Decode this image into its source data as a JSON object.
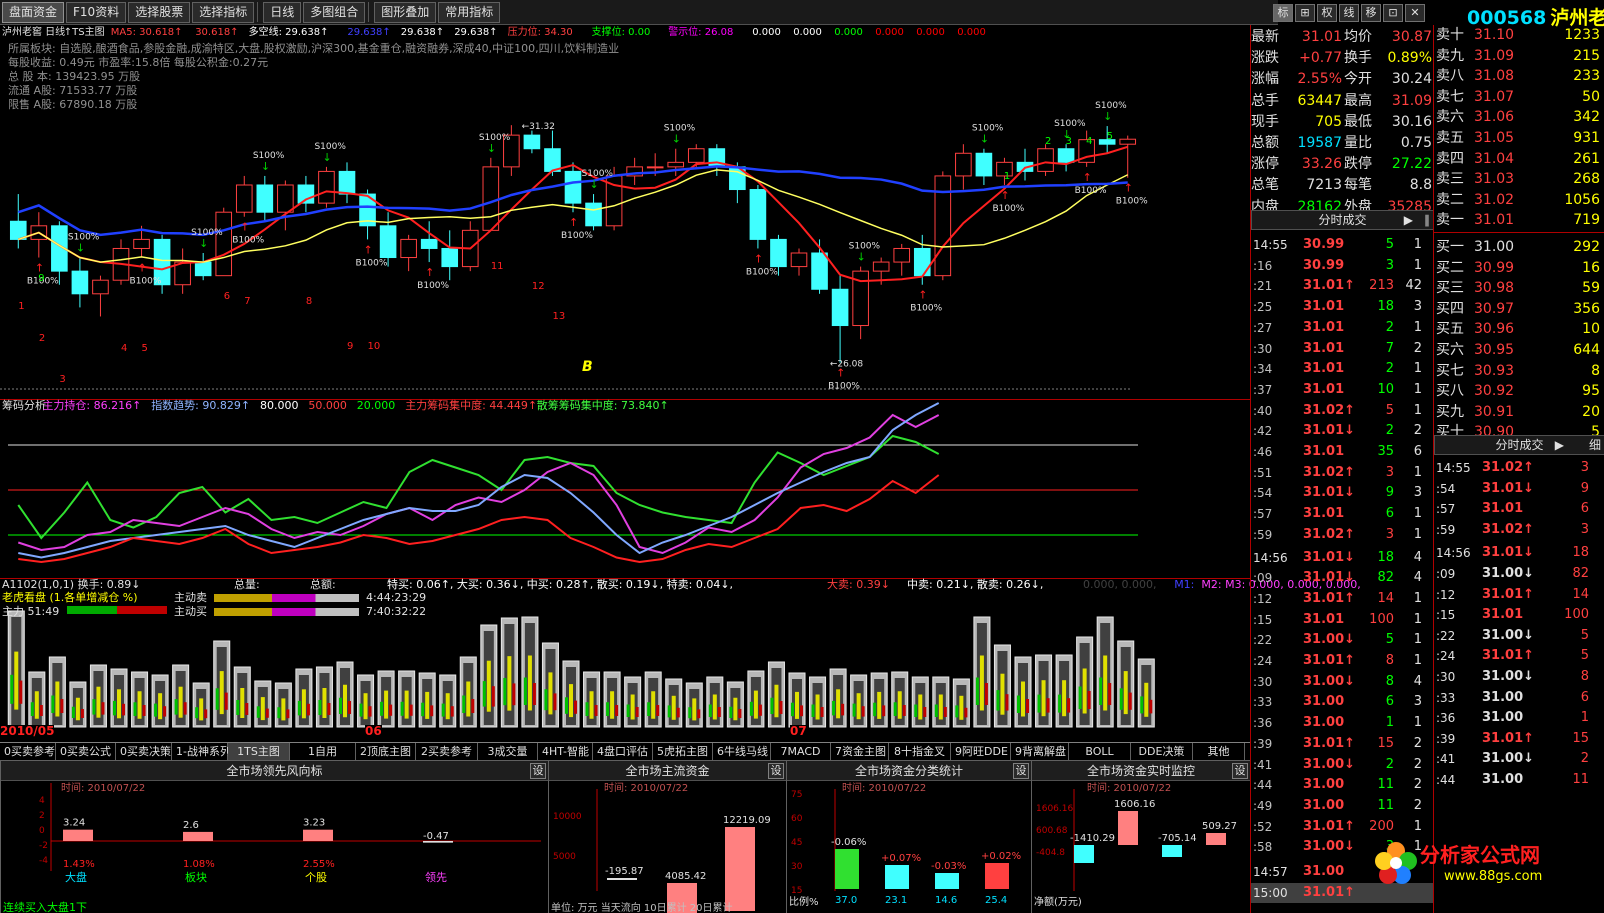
{
  "toolbar": {
    "items": [
      "盘面资金",
      "F10资料",
      "选择股票",
      "选择指标",
      "日线",
      "多图组合",
      "图形叠加",
      "常用指标"
    ],
    "right_tools": [
      "标",
      "⊞",
      "权",
      "线",
      "移",
      "⊡",
      "✕"
    ]
  },
  "stock": {
    "code": "000568",
    "name": "泸州老窖"
  },
  "chart": {
    "title_line": [
      {
        "t": "泸州老窖 日线",
        "c": "#e0e0e0"
      },
      {
        "t": "↑TS主图",
        "c": "#e0e0e0"
      },
      {
        "t": "MA5: 30.618↑",
        "c": "#ff4040"
      },
      {
        "t": "30.618↑",
        "c": "#ff4040"
      },
      {
        "t": "多空线: 29.638↑",
        "c": "#ffffff"
      },
      {
        "t": "29.638↑",
        "c": "#4040ff"
      },
      {
        "t": "29.638↑",
        "c": "#ffffff"
      },
      {
        "t": "29.638↑",
        "c": "#ffffff"
      },
      {
        "t": "压力位: 34.30",
        "c": "#ff4040"
      },
      {
        "t": "支撑位: 0.00",
        "c": "#00ff00"
      },
      {
        "t": "警示位: 26.08",
        "c": "#ff00ff"
      },
      {
        "t": "0.000",
        "c": "#ffffff"
      },
      {
        "t": "0.000",
        "c": "#ffffff"
      },
      {
        "t": "0.000",
        "c": "#00ff00"
      },
      {
        "t": "0.000",
        "c": "#ff0000"
      },
      {
        "t": "0.000",
        "c": "#ff0000"
      },
      {
        "t": "0.000",
        "c": "#ff0000"
      }
    ],
    "info_lines": [
      "所属板块: 自选股,酿酒食品,参股金融,成渝特区,大盘,股权激励,沪深300,基金重仓,融资融券,深成40,中证100,四川,饮料制造业",
      "每股收益: 0.49元   市盈率:15.8倍   每股公积金:0.27元",
      "总 股 本: 139423.95  万股",
      "流通 A股: 71533.77  万股",
      "限售 A股: 67890.18  万股"
    ],
    "annotations": {
      "high": "31.32",
      "low": "26.08",
      "buy": "B100%",
      "sell": "S100%",
      "b_mark": "B"
    },
    "num_labels": [
      "1",
      "2",
      "3",
      "4",
      "5",
      "6",
      "7",
      "8",
      "9",
      "10",
      "11",
      "12",
      "13",
      "1",
      "2",
      "3",
      "4",
      "5",
      "9"
    ],
    "ind_title": [
      {
        "t": "筹码分析",
        "c": "#e0e0e0"
      },
      {
        "t": "主力持仓: 86.216↑",
        "c": "#ff40ff"
      },
      {
        "t": "指数趋势: 90.829↑",
        "c": "#8fb4ff"
      },
      {
        "t": "80.000",
        "c": "#ffffff"
      },
      {
        "t": "50.000",
        "c": "#ff4040"
      },
      {
        "t": "20.000",
        "c": "#00ff00"
      },
      {
        "t": "主力筹码集中度: 44.449↑",
        "c": "#ff4040"
      },
      {
        "t": "散筹筹码集中度: 73.840↑",
        "c": "#40ff40"
      }
    ],
    "vol_title": [
      {
        "t": "A1102(1,0,1)  换手: 0.89↓",
        "c": "#e0e0e0"
      },
      {
        "t": "总量:",
        "c": "#e0e0e0"
      },
      {
        "t": "总额:",
        "c": "#e0e0e0"
      },
      {
        "t": "特买: 0.06↑, 大买: 0.36↓, 中买: 0.28↑, 散买: 0.19↓, 特卖: 0.04↓,",
        "c": "#ffffff"
      },
      {
        "t": "大卖: 0.39↓",
        "c": "#ff4040"
      },
      {
        "t": "中卖: 0.21↓, 散卖: 0.26↓,",
        "c": "#ffffff"
      },
      {
        "t": "0.000, 0.000,",
        "c": "#404040"
      },
      {
        "t": "M1:",
        "c": "#4040ff"
      },
      {
        "t": "M2: M3: 0.000, 0.000, 0.000,",
        "c": "#ff40ff"
      }
    ],
    "vol_box": {
      "l1": "老虎看盘  (1.各单增减仓 %)",
      "l2": "主力 51:49",
      "b1": "主动卖",
      "b2": "主动买",
      "t1": "4:44:23:29",
      "t2": "7:40:32:22"
    },
    "dates": [
      "2010/05",
      "06",
      "07"
    ]
  },
  "chart_data": {
    "type": "candlestick",
    "ohlc": [
      [
        29.2,
        29.8,
        28.6,
        28.8
      ],
      [
        28.8,
        29.4,
        28.4,
        29.1
      ],
      [
        29.1,
        29.2,
        27.8,
        28.1
      ],
      [
        28.1,
        28.4,
        27.3,
        27.6
      ],
      [
        27.6,
        28.0,
        27.1,
        27.9
      ],
      [
        27.9,
        28.8,
        27.8,
        28.6
      ],
      [
        28.6,
        29.1,
        28.4,
        28.8
      ],
      [
        28.8,
        28.9,
        27.6,
        27.8
      ],
      [
        27.8,
        28.6,
        27.6,
        28.3
      ],
      [
        28.3,
        28.5,
        27.9,
        28.0
      ],
      [
        28.0,
        29.5,
        28.0,
        29.4
      ],
      [
        29.4,
        30.2,
        29.3,
        30.0
      ],
      [
        30.0,
        30.2,
        29.2,
        29.4
      ],
      [
        29.4,
        30.1,
        29.0,
        30.0
      ],
      [
        30.0,
        30.2,
        29.4,
        29.6
      ],
      [
        29.6,
        30.4,
        29.5,
        30.3
      ],
      [
        30.3,
        30.5,
        29.6,
        29.8
      ],
      [
        29.8,
        29.9,
        28.8,
        29.1
      ],
      [
        29.1,
        29.4,
        28.2,
        28.4
      ],
      [
        28.4,
        28.9,
        28.1,
        28.8
      ],
      [
        28.8,
        29.2,
        28.3,
        28.6
      ],
      [
        28.6,
        29.0,
        27.9,
        28.2
      ],
      [
        28.2,
        29.2,
        28.1,
        29.0
      ],
      [
        29.0,
        30.6,
        29.0,
        30.4
      ],
      [
        30.4,
        31.32,
        30.2,
        31.1
      ],
      [
        31.1,
        31.2,
        30.7,
        30.8
      ],
      [
        30.8,
        31.2,
        30.2,
        30.3
      ],
      [
        30.3,
        30.5,
        29.4,
        29.6
      ],
      [
        29.6,
        29.8,
        29.0,
        29.1
      ],
      [
        29.1,
        30.4,
        29.0,
        30.2
      ],
      [
        30.2,
        30.6,
        30.0,
        30.4
      ],
      [
        30.4,
        30.7,
        30.2,
        30.4
      ],
      [
        30.4,
        30.8,
        30.2,
        30.5
      ],
      [
        30.5,
        30.9,
        30.4,
        30.8
      ],
      [
        30.8,
        30.9,
        30.2,
        30.4
      ],
      [
        30.4,
        30.5,
        29.6,
        29.9
      ],
      [
        29.9,
        30.0,
        28.6,
        28.8
      ],
      [
        28.8,
        28.9,
        28.0,
        28.2
      ],
      [
        28.2,
        28.6,
        28.0,
        28.5
      ],
      [
        28.5,
        28.8,
        27.6,
        27.7
      ],
      [
        27.7,
        28.0,
        26.08,
        26.9
      ],
      [
        26.9,
        28.2,
        26.6,
        28.1
      ],
      [
        28.1,
        28.4,
        27.8,
        28.3
      ],
      [
        28.3,
        28.7,
        28.0,
        28.6
      ],
      [
        28.6,
        28.9,
        27.8,
        28.0
      ],
      [
        28.0,
        30.3,
        27.9,
        30.2
      ],
      [
        30.2,
        30.9,
        29.9,
        30.7
      ],
      [
        30.7,
        30.8,
        30.0,
        30.2
      ],
      [
        30.2,
        30.6,
        30.0,
        30.5
      ],
      [
        30.5,
        30.8,
        30.1,
        30.3
      ],
      [
        30.3,
        30.9,
        30.2,
        30.8
      ],
      [
        30.8,
        30.9,
        30.3,
        30.5
      ],
      [
        30.5,
        31.2,
        30.4,
        31.0
      ],
      [
        31.0,
        31.3,
        30.7,
        30.9
      ],
      [
        30.9,
        31.09,
        30.16,
        31.01
      ]
    ],
    "ylim": [
      25.5,
      33
    ],
    "ind_ylim": [
      0,
      100
    ],
    "lines": {
      "ma5": "red",
      "ma_long": "yellow",
      "trend": "blue/green"
    },
    "series": [
      {
        "name": "主力持仓",
        "end": 86.216
      },
      {
        "name": "指数趋势",
        "end": 90.829
      },
      {
        "name": "主力筹码集中度",
        "end": 44.449
      },
      {
        "name": "散筹筹码集中度",
        "end": 73.84
      }
    ]
  },
  "tabs": [
    "0买卖参考",
    "0买卖公式",
    "0买卖决策",
    "1-战神系列",
    "1TS主图",
    "1自用",
    "2顶底主图",
    "2买卖参考",
    "3成交量",
    "4HT-智能",
    "4盘口评估",
    "5虎拓主图",
    "6牛线马线",
    "7MACD",
    "7资金主图",
    "8十指金叉",
    "9阿旺DDE",
    "9背离解盘",
    "BOLL",
    "DDE决策",
    "其他"
  ],
  "panels": [
    {
      "title": "全市场领先风向标",
      "date": "时间: 2010/07/22",
      "bars": [
        {
          "v": "3.24",
          "p": "1.43%",
          "l": "大盘",
          "c": "#00e0ff"
        },
        {
          "v": "2.6",
          "p": "1.08%",
          "l": "板块",
          "c": "#00ff00"
        },
        {
          "v": "3.23",
          "p": "2.55%",
          "l": "个股",
          "c": "#ffff00"
        },
        {
          "v": "-0.47",
          "p": "",
          "l": "领先",
          "c": "#ff40ff"
        }
      ],
      "footer": "连续买入大盘1下"
    },
    {
      "title": "全市场主流资金",
      "date": "时间: 2010/07/22",
      "axis": [
        "10000",
        "5000"
      ],
      "bars": [
        {
          "v": "-195.87"
        },
        {
          "v": "4085.42"
        },
        {
          "v": "12219.09"
        }
      ],
      "footer": "单位: 万元  当天流向     10日累计   20日累计"
    },
    {
      "title": "全市场资金分类统计",
      "date": "时间: 2010/07/22",
      "axis": [
        "75",
        "60",
        "45",
        "30",
        "15"
      ],
      "bars": [
        {
          "v": "-0.06%",
          "p": "37.0"
        },
        {
          "v": "+0.07%",
          "p": "23.1"
        },
        {
          "v": "-0.03%",
          "p": "14.6"
        },
        {
          "v": "+0.02%",
          "p": "25.4"
        }
      ],
      "footer": "比例%"
    },
    {
      "title": "全市场资金实时监控",
      "date": "时间: 2010/07/22",
      "axis": [
        "1606.16",
        "600.68",
        "-404.8"
      ],
      "bars": [
        {
          "v": "-1410.29"
        },
        {
          "v": "1606.16"
        },
        {
          "v": "-705.14"
        },
        {
          "v": "509.27"
        }
      ],
      "footer": "净额(万元)"
    }
  ],
  "quote": [
    {
      "l": "最新",
      "v": "31.01",
      "c": "#ff4040",
      "l2": "均价",
      "v2": "30.87",
      "c2": "#ff4040"
    },
    {
      "l": "涨跌",
      "v": "+0.77",
      "c": "#ff4040",
      "l2": "换手",
      "v2": "0.89%",
      "c2": "#ffff00"
    },
    {
      "l": "涨幅",
      "v": "2.55%",
      "c": "#ff4040",
      "l2": "今开",
      "v2": "30.24",
      "c2": "#e0e0e0"
    },
    {
      "l": "总手",
      "v": "63447",
      "c": "#ffff00",
      "l2": "最高",
      "v2": "31.09",
      "c2": "#ff4040"
    },
    {
      "l": "现手",
      "v": "705",
      "c": "#ffff00",
      "l2": "最低",
      "v2": "30.16",
      "c2": "#e0e0e0"
    },
    {
      "l": "总额",
      "v": "19587",
      "c": "#00e0ff",
      "l2": "量比",
      "v2": "0.75",
      "c2": "#e0e0e0"
    },
    {
      "l": "涨停",
      "v": "33.26",
      "c": "#ff4040",
      "l2": "跌停",
      "v2": "27.22",
      "c2": "#00ff00"
    },
    {
      "l": "总笔",
      "v": "7213",
      "c": "#e0e0e0",
      "l2": "每笔",
      "v2": "8.8",
      "c2": "#e0e0e0"
    },
    {
      "l": "内盘",
      "v": "28162",
      "c": "#00ff00",
      "l2": "外盘",
      "v2": "35285",
      "c2": "#ff4040"
    }
  ],
  "fenshi_title": "分时成交",
  "ticks": [
    {
      "t": "14:55",
      "p": "30.99",
      "a": "",
      "v": "5",
      "n": "1",
      "vc": "#00ff00"
    },
    {
      "t": ":16",
      "p": "30.99",
      "a": "",
      "v": "3",
      "n": "1",
      "vc": "#00ff00"
    },
    {
      "t": ":21",
      "p": "31.01",
      "a": "↑",
      "v": "213",
      "n": "42",
      "vc": "#ff4040"
    },
    {
      "t": ":25",
      "p": "31.01",
      "a": "",
      "v": "18",
      "n": "3",
      "vc": "#00ff00"
    },
    {
      "t": ":27",
      "p": "31.01",
      "a": "",
      "v": "2",
      "n": "1",
      "vc": "#00ff00"
    },
    {
      "t": ":30",
      "p": "31.01",
      "a": "",
      "v": "7",
      "n": "2",
      "vc": "#00ff00"
    },
    {
      "t": ":34",
      "p": "31.01",
      "a": "",
      "v": "2",
      "n": "1",
      "vc": "#00ff00"
    },
    {
      "t": ":37",
      "p": "31.01",
      "a": "",
      "v": "10",
      "n": "1",
      "vc": "#00ff00"
    },
    {
      "t": ":40",
      "p": "31.02",
      "a": "↑",
      "v": "5",
      "n": "1",
      "vc": "#ff4040"
    },
    {
      "t": ":42",
      "p": "31.01",
      "a": "↓",
      "v": "2",
      "n": "2",
      "vc": "#00ff00"
    },
    {
      "t": ":46",
      "p": "31.01",
      "a": "",
      "v": "35",
      "n": "6",
      "vc": "#00ff00"
    },
    {
      "t": ":51",
      "p": "31.02",
      "a": "↑",
      "v": "3",
      "n": "1",
      "vc": "#ff4040"
    },
    {
      "t": ":54",
      "p": "31.01",
      "a": "↓",
      "v": "9",
      "n": "3",
      "vc": "#00ff00"
    },
    {
      "t": ":57",
      "p": "31.01",
      "a": "",
      "v": "6",
      "n": "1",
      "vc": "#00ff00"
    },
    {
      "t": ":59",
      "p": "31.02",
      "a": "↑",
      "v": "3",
      "n": "1",
      "vc": "#ff4040"
    },
    {
      "t": "14:56",
      "p": "31.01",
      "a": "↓",
      "v": "18",
      "n": "4",
      "vc": "#00ff00"
    },
    {
      "t": ":09",
      "p": "31.01",
      "a": "↓",
      "v": "82",
      "n": "4",
      "vc": "#00ff00"
    },
    {
      "t": ":12",
      "p": "31.01",
      "a": "↑",
      "v": "14",
      "n": "1",
      "vc": "#ff4040"
    },
    {
      "t": ":15",
      "p": "31.01",
      "a": "",
      "v": "100",
      "n": "1",
      "vc": "#ff4040"
    },
    {
      "t": ":22",
      "p": "31.00",
      "a": "↓",
      "v": "5",
      "n": "1",
      "vc": "#00ff00"
    },
    {
      "t": ":24",
      "p": "31.01",
      "a": "↑",
      "v": "8",
      "n": "1",
      "vc": "#ff4040"
    },
    {
      "t": ":30",
      "p": "31.00",
      "a": "↓",
      "v": "8",
      "n": "4",
      "vc": "#00ff00"
    },
    {
      "t": ":33",
      "p": "31.00",
      "a": "",
      "v": "6",
      "n": "3",
      "vc": "#00ff00"
    },
    {
      "t": ":36",
      "p": "31.00",
      "a": "",
      "v": "1",
      "n": "1",
      "vc": "#00ff00"
    },
    {
      "t": ":39",
      "p": "31.01",
      "a": "↑",
      "v": "15",
      "n": "2",
      "vc": "#ff4040"
    },
    {
      "t": ":41",
      "p": "31.00",
      "a": "↓",
      "v": "2",
      "n": "2",
      "vc": "#00ff00"
    },
    {
      "t": ":44",
      "p": "31.00",
      "a": "",
      "v": "11",
      "n": "2",
      "vc": "#00ff00"
    },
    {
      "t": ":49",
      "p": "31.00",
      "a": "",
      "v": "11",
      "n": "2",
      "vc": "#00ff00"
    },
    {
      "t": ":52",
      "p": "31.01",
      "a": "↑",
      "v": "200",
      "n": "1",
      "vc": "#ff4040"
    },
    {
      "t": ":58",
      "p": "31.00",
      "a": "↓",
      "v": "3",
      "n": "1",
      "vc": "#00ff00"
    },
    {
      "t": "14:57",
      "p": "31.00",
      "a": "",
      "v": "",
      "n": "",
      "vc": "#00ff00"
    },
    {
      "t": "15:00",
      "p": "31.01",
      "a": "↑",
      "v": "",
      "n": "",
      "vc": "#ff4040"
    }
  ],
  "orderbook": [
    {
      "l": "卖十",
      "p": "31.10",
      "v": "1233"
    },
    {
      "l": "卖九",
      "p": "31.09",
      "v": "215"
    },
    {
      "l": "卖八",
      "p": "31.08",
      "v": "233"
    },
    {
      "l": "卖七",
      "p": "31.07",
      "v": "50"
    },
    {
      "l": "卖六",
      "p": "31.06",
      "v": "342"
    },
    {
      "l": "卖五",
      "p": "31.05",
      "v": "931"
    },
    {
      "l": "卖四",
      "p": "31.04",
      "v": "261"
    },
    {
      "l": "卖三",
      "p": "31.03",
      "v": "268"
    },
    {
      "l": "卖二",
      "p": "31.02",
      "v": "1056"
    },
    {
      "l": "卖一",
      "p": "31.01",
      "v": "719"
    },
    {
      "l": "买一",
      "p": "31.00",
      "v": "292"
    },
    {
      "l": "买二",
      "p": "30.99",
      "v": "16"
    },
    {
      "l": "买三",
      "p": "30.98",
      "v": "59"
    },
    {
      "l": "买四",
      "p": "30.97",
      "v": "356"
    },
    {
      "l": "买五",
      "p": "30.96",
      "v": "10"
    },
    {
      "l": "买六",
      "p": "30.95",
      "v": "644"
    },
    {
      "l": "买七",
      "p": "30.93",
      "v": "8"
    },
    {
      "l": "买八",
      "p": "30.92",
      "v": "95"
    },
    {
      "l": "买九",
      "p": "30.91",
      "v": "20"
    },
    {
      "l": "买十",
      "p": "30.90",
      "v": "5"
    }
  ],
  "ticks2": [
    {
      "t": "14:55",
      "p": "31.02",
      "a": "↑",
      "v": "3"
    },
    {
      "t": ":54",
      "p": "31.01",
      "a": "↓",
      "v": "9"
    },
    {
      "t": ":57",
      "p": "31.01",
      "a": "",
      "v": "6"
    },
    {
      "t": ":59",
      "p": "31.02",
      "a": "↑",
      "v": "3"
    },
    {
      "t": "14:56",
      "p": "31.01",
      "a": "↓",
      "v": "18"
    },
    {
      "t": ":09",
      "p": "31.00",
      "a": "↓",
      "v": "82"
    },
    {
      "t": ":12",
      "p": "31.01",
      "a": "↑",
      "v": "14"
    },
    {
      "t": ":15",
      "p": "31.01",
      "a": "",
      "v": "100"
    },
    {
      "t": ":22",
      "p": "31.00",
      "a": "↓",
      "v": "5"
    },
    {
      "t": ":24",
      "p": "31.01",
      "a": "↑",
      "v": "5"
    },
    {
      "t": ":30",
      "p": "31.00",
      "a": "↓",
      "v": "8"
    },
    {
      "t": ":33",
      "p": "31.00",
      "a": "",
      "v": "6"
    },
    {
      "t": ":36",
      "p": "31.00",
      "a": "",
      "v": "1"
    },
    {
      "t": ":39",
      "p": "31.01",
      "a": "↑",
      "v": "15"
    },
    {
      "t": ":41",
      "p": "31.00",
      "a": "↓",
      "v": "2"
    },
    {
      "t": ":44",
      "p": "31.00",
      "a": "",
      "v": "11"
    }
  ],
  "watermark": {
    "brand": "分析家公式网",
    "url": "www.88gs.com"
  }
}
